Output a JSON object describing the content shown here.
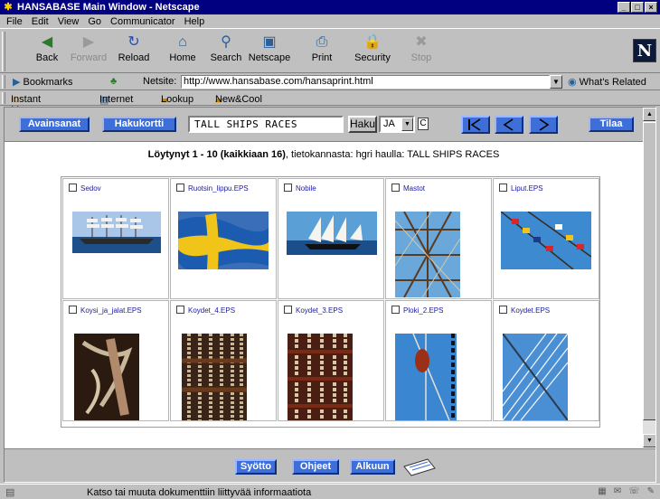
{
  "window": {
    "title": "HANSABASE Main Window - Netscape"
  },
  "menu": [
    "File",
    "Edit",
    "View",
    "Go",
    "Communicator",
    "Help"
  ],
  "toolbar": {
    "buttons": [
      {
        "label": "Back",
        "icon": "back-icon",
        "enabled": true
      },
      {
        "label": "Forward",
        "icon": "forward-icon",
        "enabled": false
      },
      {
        "label": "Reload",
        "icon": "reload-icon",
        "enabled": true
      },
      {
        "label": "Home",
        "icon": "home-icon",
        "enabled": true
      },
      {
        "label": "Search",
        "icon": "search-icon",
        "enabled": true
      },
      {
        "label": "Netscape",
        "icon": "netscape-icon",
        "enabled": true
      },
      {
        "label": "Print",
        "icon": "print-icon",
        "enabled": true
      },
      {
        "label": "Security",
        "icon": "security-icon",
        "enabled": true
      },
      {
        "label": "Stop",
        "icon": "stop-icon",
        "enabled": false
      }
    ]
  },
  "location": {
    "bookmarks_label": "Bookmarks",
    "netsite_label": "Netsite:",
    "url": "http://www.hansabase.com/hansaprint.html",
    "related_label": "What's Related"
  },
  "personal_toolbar": [
    "Instant Message",
    "Internet",
    "Lookup",
    "New&Cool"
  ],
  "page": {
    "nav": {
      "avainsanat": "Avainsanat",
      "hakukortti": "Hakukortti",
      "search_value": "TALL SHIPS RACES",
      "haku_button": "Haku",
      "operator": "JA",
      "c_label": "C",
      "tilaa": "Tilaa"
    },
    "results": {
      "range": "Löytynyt 1 - 10 (kaikkiaan 16)",
      "rest": ", tietokannasta: hgri haulla: TALL SHIPS RACES"
    },
    "items": [
      {
        "name": "Sedov"
      },
      {
        "name": "Ruotsin_lippu.EPS"
      },
      {
        "name": "Nobile"
      },
      {
        "name": "Mastot"
      },
      {
        "name": "Liput.EPS"
      },
      {
        "name": "Koysi_ja_jalat.EPS"
      },
      {
        "name": "Koydet_4.EPS"
      },
      {
        "name": "Koydet_3.EPS"
      },
      {
        "name": "Ploki_2.EPS"
      },
      {
        "name": "Koydet.EPS"
      }
    ],
    "bottom": {
      "syotto": "Syötto",
      "ohjeet": "Ohjeet",
      "alkuun": "Alkuun"
    }
  },
  "status": {
    "message": "Katso tai muuta dokumenttiin liittyvää informaatiota"
  }
}
